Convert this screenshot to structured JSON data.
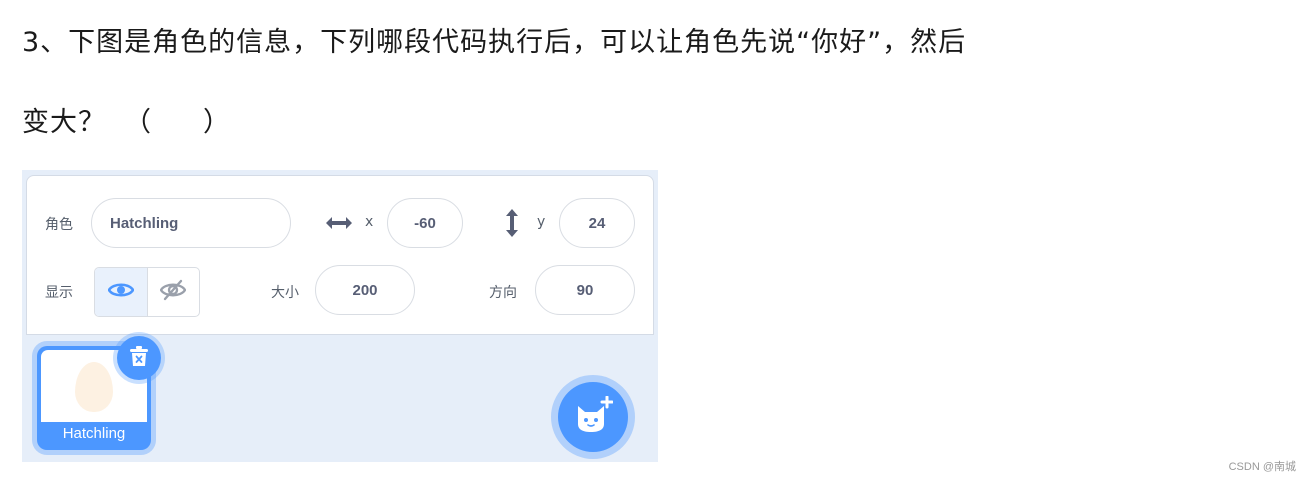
{
  "question": {
    "line1": "3、下图是角色的信息，下列哪段代码执行后，可以让角色先说“你好”，然后",
    "line2": "变大？",
    "paren_open": "（",
    "paren_close": "）"
  },
  "sprite_info": {
    "sprite_label": "角色",
    "sprite_name": "Hatchling",
    "x_label": "x",
    "x_value": "-60",
    "y_label": "y",
    "y_value": "24",
    "show_label": "显示",
    "size_label": "大小",
    "size_value": "200",
    "direction_label": "方向",
    "direction_value": "90"
  },
  "sprite_list": {
    "items": [
      {
        "name": "Hatchling",
        "selected": true
      }
    ]
  },
  "icons": {
    "x_axis": "horizontal-arrows-icon",
    "y_axis": "vertical-arrows-icon",
    "show": "eye-icon",
    "hide": "eye-slash-icon",
    "delete": "trash-icon",
    "add_sprite": "cat-plus-icon"
  },
  "colors": {
    "accent": "#4c97ff",
    "panel_bg": "#e6eef9",
    "text": "#575e75"
  },
  "watermark": "CSDN @南城"
}
